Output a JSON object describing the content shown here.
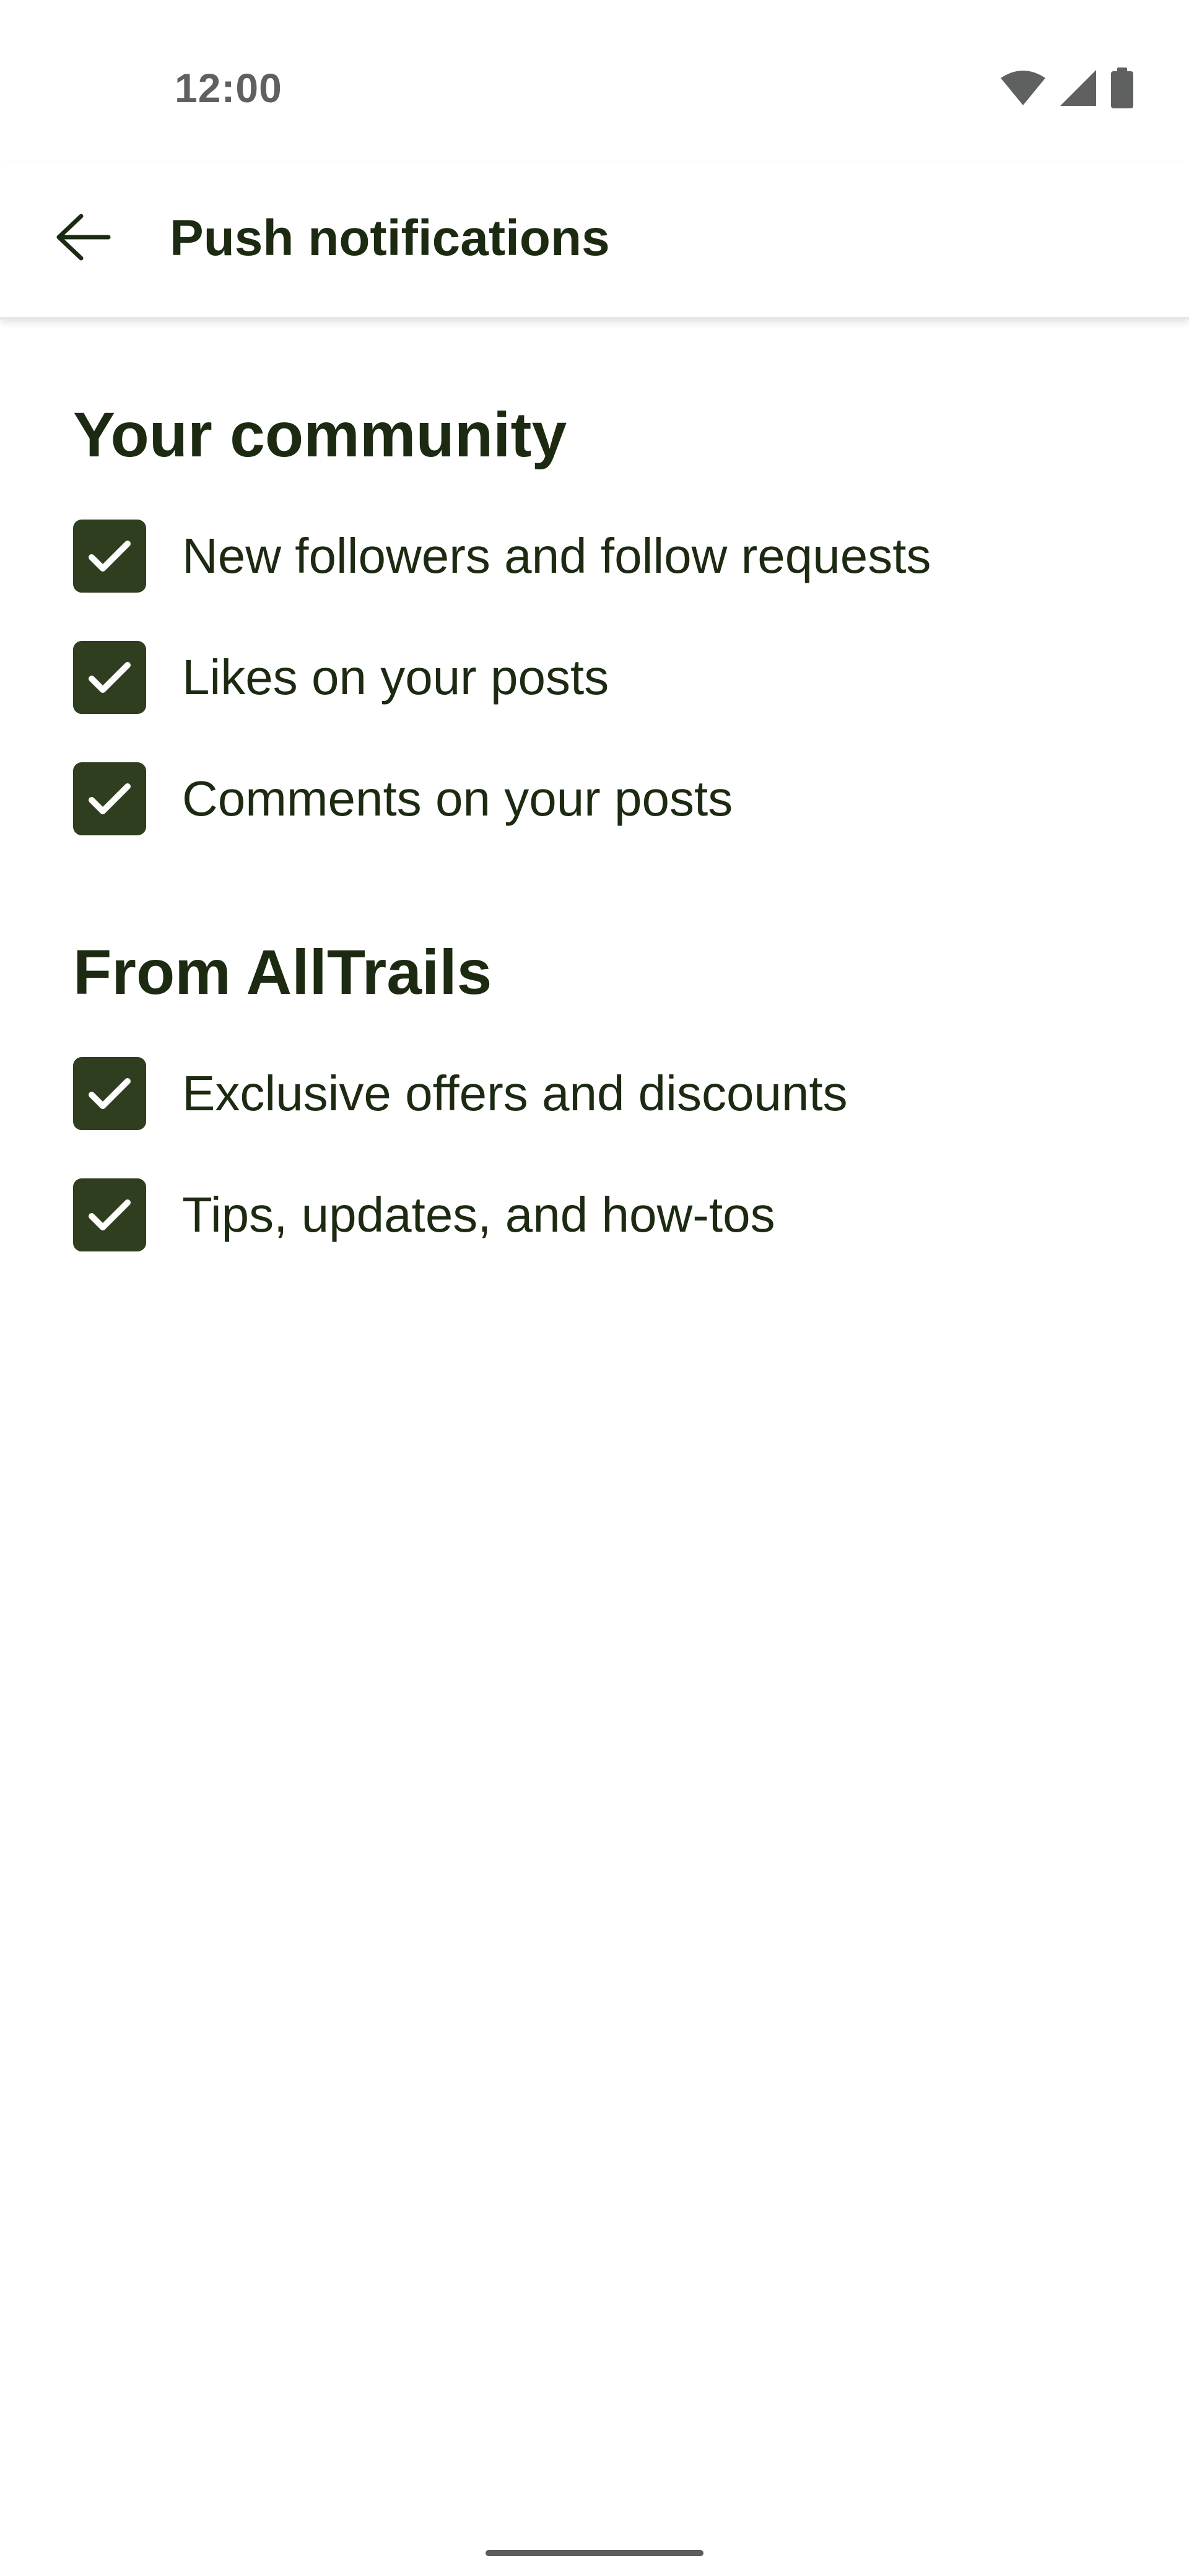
{
  "status_bar": {
    "time": "12:00",
    "icons": [
      "wifi-icon",
      "cell-signal-icon",
      "battery-icon"
    ]
  },
  "app_bar": {
    "back_icon": "arrow-left-icon",
    "title": "Push notifications"
  },
  "sections": [
    {
      "title": "Your community",
      "items": [
        {
          "label": "New followers and follow requests",
          "checked": true
        },
        {
          "label": "Likes on your posts",
          "checked": true
        },
        {
          "label": "Comments on your posts",
          "checked": true
        }
      ]
    },
    {
      "title": "From AllTrails",
      "items": [
        {
          "label": "Exclusive offers and discounts",
          "checked": true
        },
        {
          "label": "Tips, updates, and how-tos",
          "checked": true
        }
      ]
    }
  ],
  "colors": {
    "checkbox_fill": "#2e3e1f",
    "text": "#1c2a12",
    "status_icons": "#5f6160"
  }
}
